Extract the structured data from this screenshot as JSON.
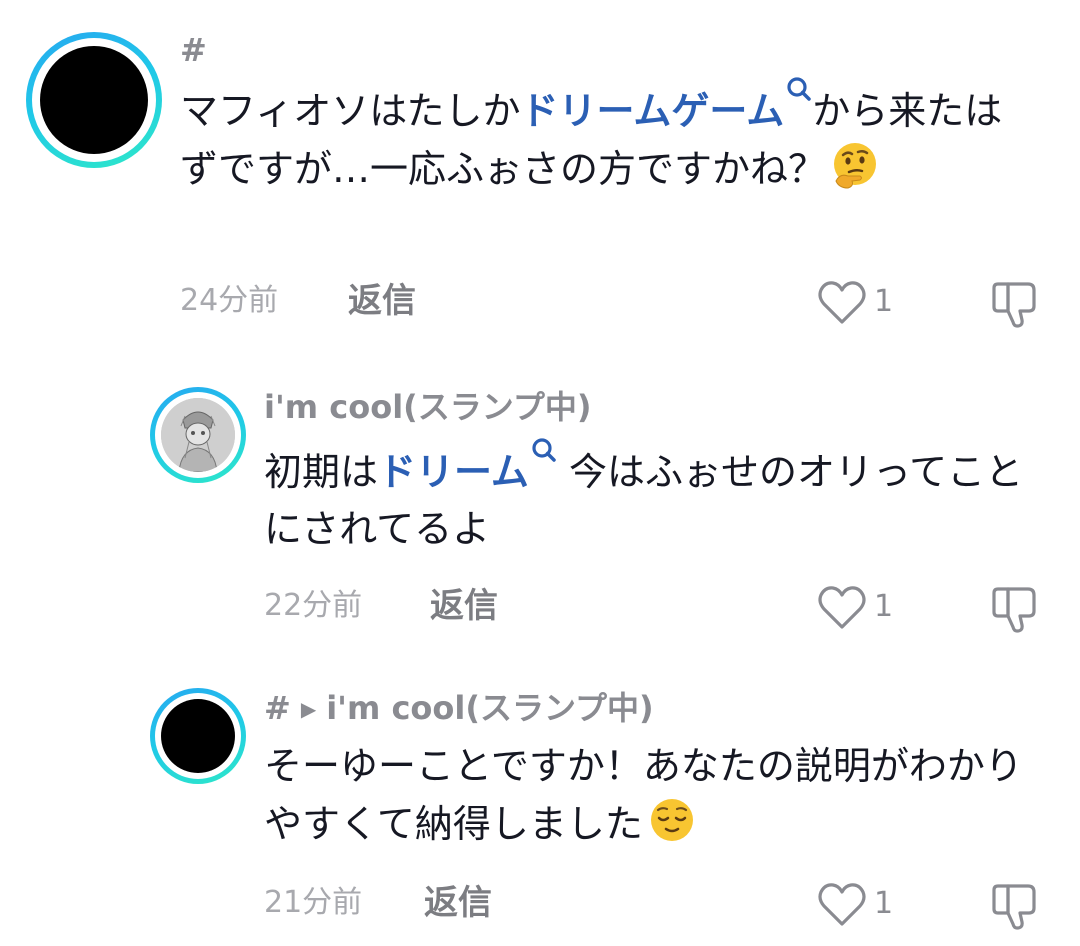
{
  "comments": [
    {
      "username": "#",
      "text_before": "マフィオソはたしか",
      "link_text": "ドリームゲーム",
      "text_after": "から来たはずですが…一応ふぉさの方ですかね？",
      "emoji": "thinking-face-emoji",
      "time": "24分前",
      "reply_label": "返信",
      "like_count": "1"
    },
    {
      "username": "i'm cool(スランプ中)",
      "text_before": "初期は",
      "link_text": "ドリーム",
      "text_after": " 今はふぉせのオリってことにされてるよ",
      "time": "22分前",
      "reply_label": "返信",
      "like_count": "1"
    },
    {
      "username": "#",
      "reply_to": "i'm cool(スランプ中)",
      "text": "そーゆーことですか！あなたの説明がわかりやすくて納得しました",
      "emoji": "relieved-face-emoji",
      "time": "21分前",
      "reply_label": "返信",
      "like_count": "1"
    }
  ],
  "colors": {
    "link": "#2b5fb4",
    "avatar_ring_start": "#27a8f0",
    "avatar_ring_end": "#2ee8c8",
    "meta_text": "#a8a9ae"
  },
  "icons": {
    "like": "heart-outline-icon",
    "dislike": "thumbs-down-outline-icon",
    "search": "search-icon",
    "reply_arrow": "play-arrow-icon"
  }
}
